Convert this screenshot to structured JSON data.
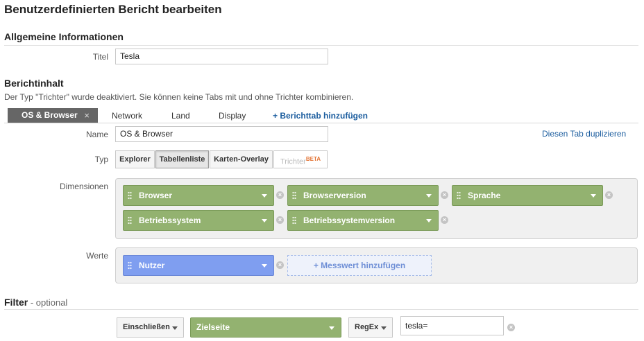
{
  "page_title": "Benutzerdefinierten Bericht bearbeiten",
  "general": {
    "section_title": "Allgemeine Informationen",
    "title_label": "Titel",
    "title_value": "Tesla"
  },
  "content": {
    "section_title": "Berichtinhalt",
    "note": "Der Typ \"Trichter\" wurde deaktiviert. Sie können keine Tabs mit und ohne Trichter kombinieren.",
    "tabs": [
      {
        "label": "OS & Browser",
        "close": "×"
      },
      {
        "label": "Network"
      },
      {
        "label": "Land"
      },
      {
        "label": "Display"
      }
    ],
    "add_tab": "+ Berichttab hinzufügen",
    "name_label": "Name",
    "name_value": "OS & Browser",
    "duplicate_link": "Diesen Tab duplizieren",
    "type_label": "Typ",
    "types": [
      "Explorer",
      "Tabellenliste",
      "Karten-Overlay",
      "Trichter"
    ],
    "type_beta": "BETA",
    "selected_type": "Tabellenliste",
    "dimensions_label": "Dimensionen",
    "dimensions": [
      "Browser",
      "Browserversion",
      "Sprache",
      "Betriebssystem",
      "Betriebssystemversion"
    ],
    "metrics_label": "Werte",
    "metrics": [
      "Nutzer"
    ],
    "add_metric": "+ Messwert hinzufügen",
    "remove_glyph": "×"
  },
  "filter": {
    "title": "Filter",
    "optional": " - optional",
    "mode": "Einschließen",
    "dimension": "Zielseite",
    "match_type": "RegEx",
    "value": "tesla="
  },
  "colors": {
    "dimension_chip": "#93b270",
    "metric_chip": "#7f9ef0",
    "link": "#1a5c9e",
    "active_tab": "#666666",
    "beta": "#e37333"
  },
  "icons": [
    "close-icon",
    "drag-handle-icon",
    "chevron-down-icon",
    "remove-icon"
  ]
}
